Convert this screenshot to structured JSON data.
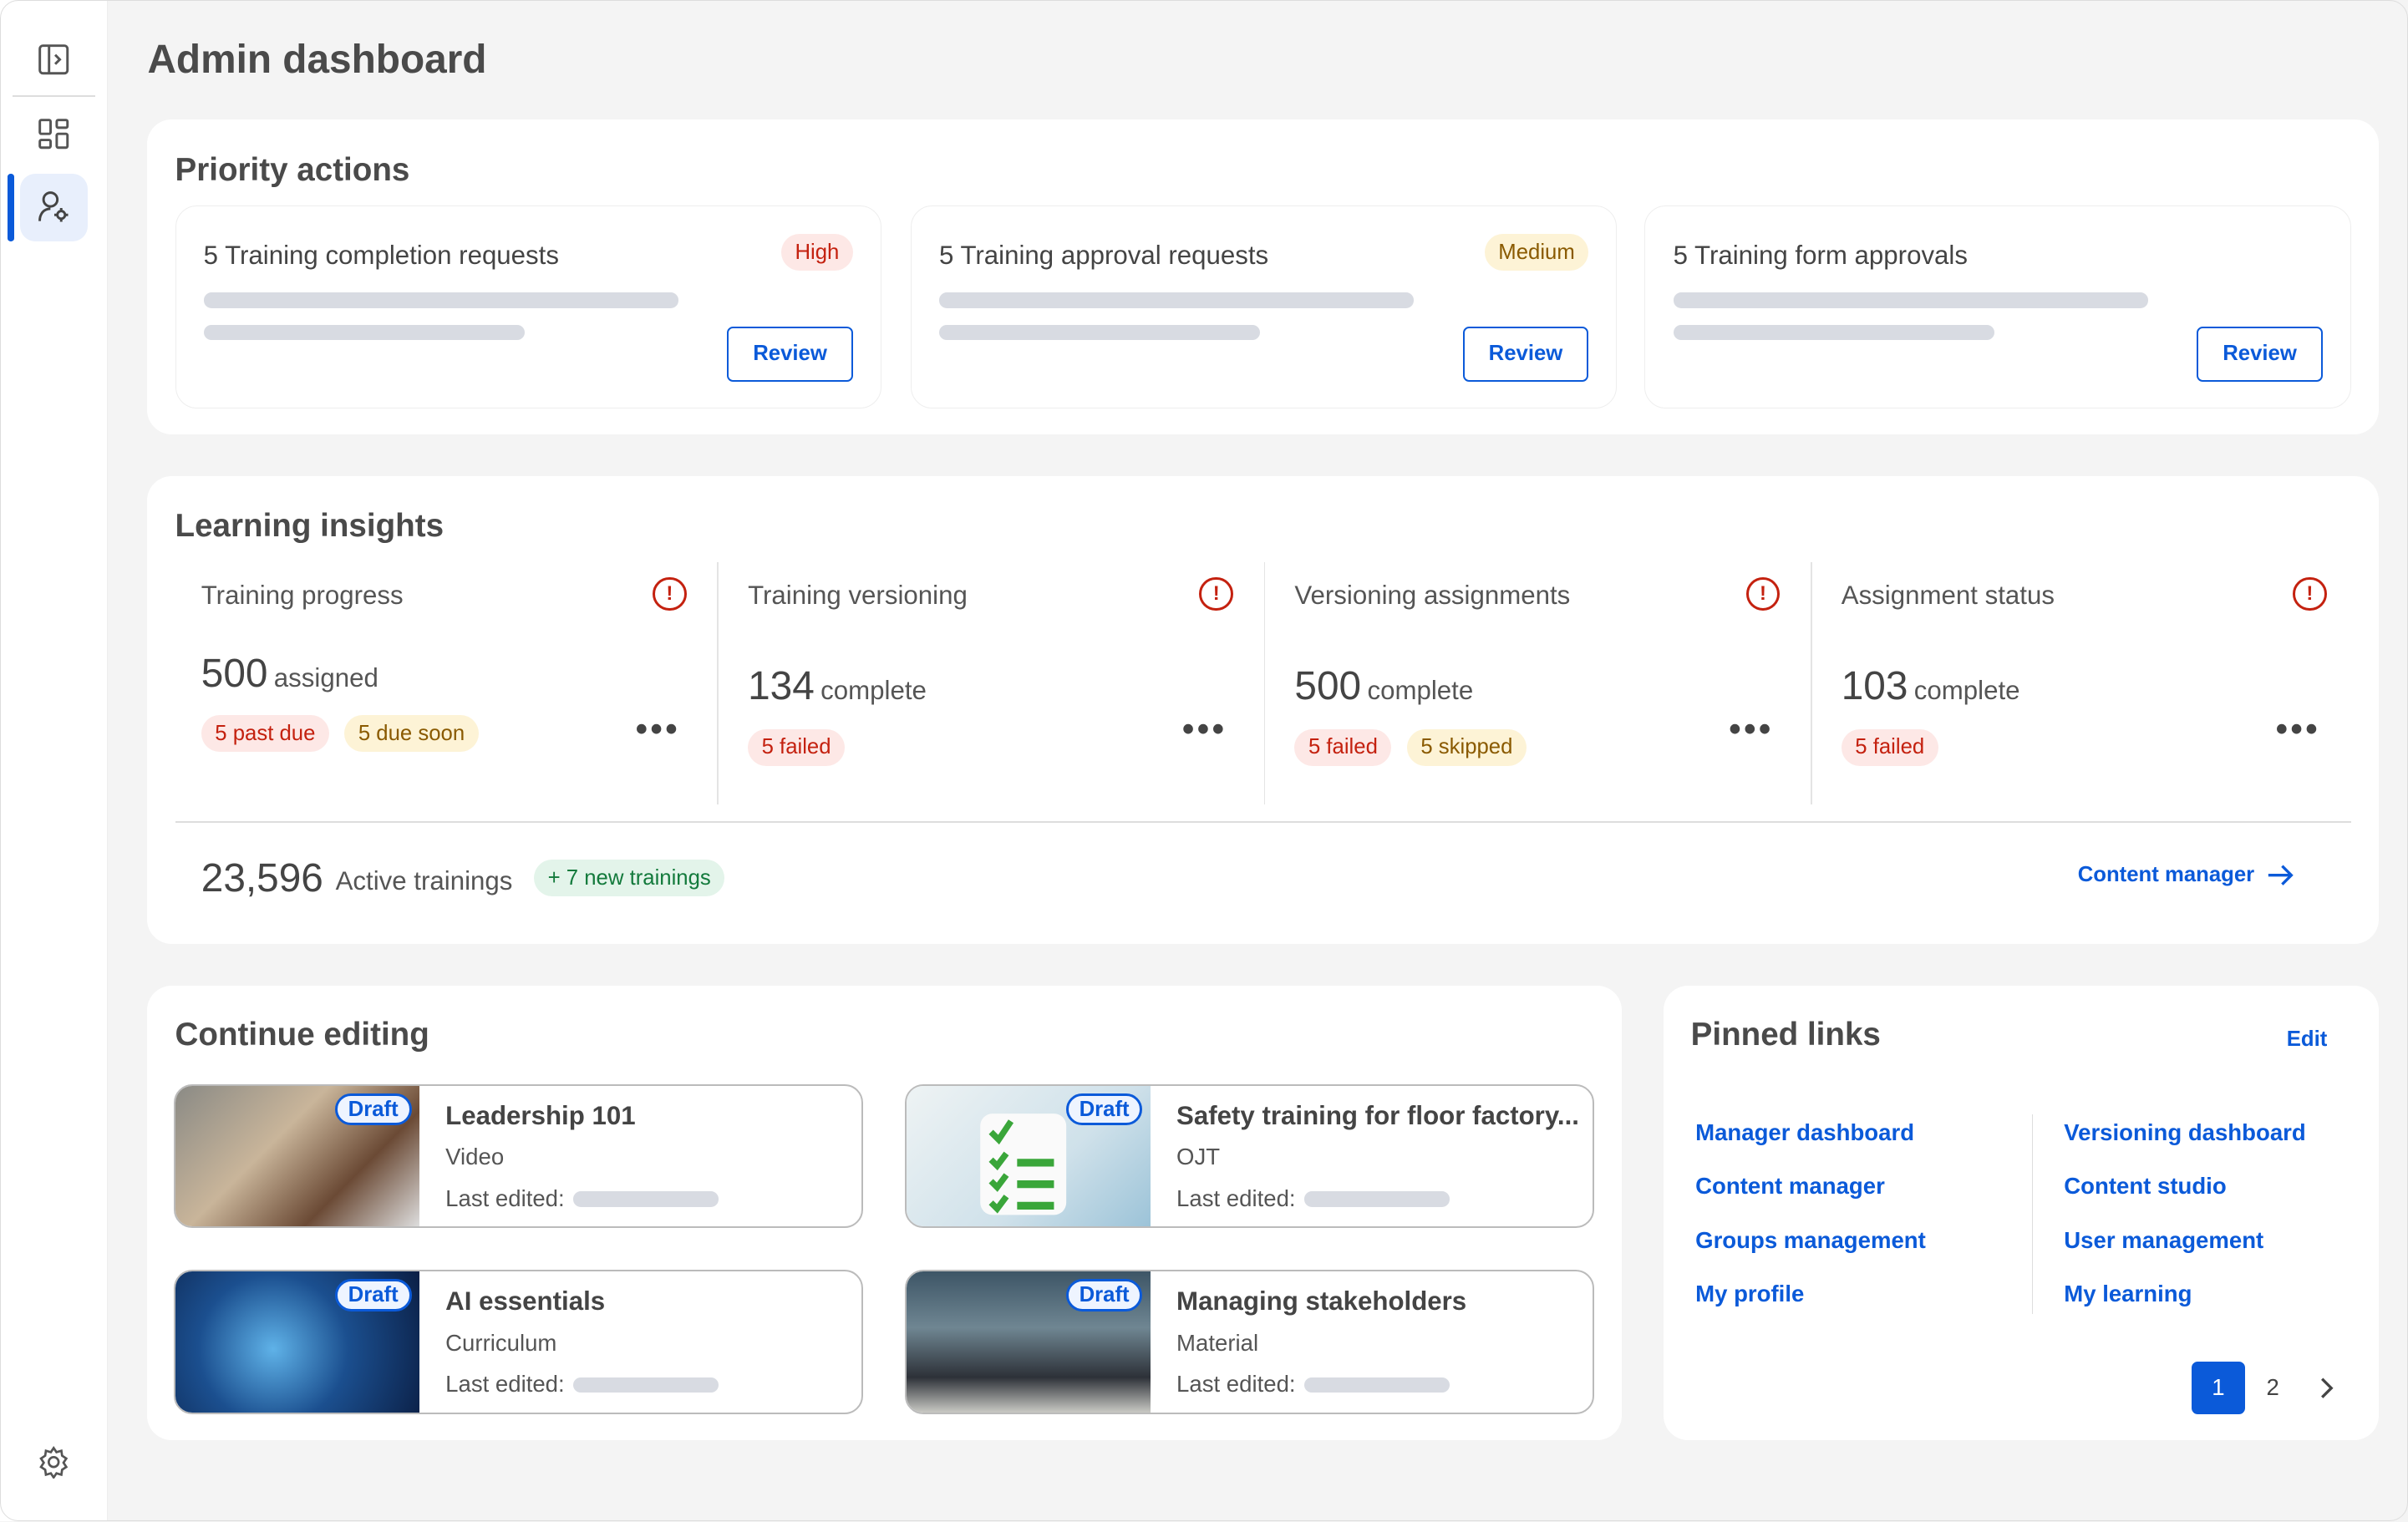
{
  "page": {
    "title": "Admin dashboard"
  },
  "sidebar": {
    "items": [
      {
        "icon": "panel-expand-icon"
      },
      {
        "icon": "dashboard-grid-icon"
      },
      {
        "icon": "user-settings-icon",
        "active": true
      }
    ],
    "footer_icon": "settings-gear-icon"
  },
  "priority": {
    "title": "Priority actions",
    "items": [
      {
        "label": "5 Training completion requests",
        "badge": "High",
        "button": "Review"
      },
      {
        "label": "5 Training approval requests",
        "badge": "Medium",
        "button": "Review"
      },
      {
        "label": "5 Training form approvals",
        "button": "Review"
      }
    ]
  },
  "insights": {
    "title": "Learning insights",
    "columns": [
      {
        "title": "Training progress",
        "value": "500",
        "unit": "assigned",
        "badges": [
          "5 past due",
          "5 due soon"
        ]
      },
      {
        "title": "Training versioning",
        "value": "134",
        "unit": "complete",
        "badges": [
          "5 failed"
        ]
      },
      {
        "title": "Versioning assignments",
        "value": "500",
        "unit": "complete",
        "badges": [
          "5 failed",
          "5 skipped"
        ]
      },
      {
        "title": "Assignment status",
        "value": "103",
        "unit": "complete",
        "badges": [
          "5 failed"
        ]
      }
    ],
    "more": "•••",
    "warn": "!",
    "active_count": "23,596",
    "active_label": "Active trainings",
    "new_badge": "+ 7 new trainings",
    "link": "Content manager"
  },
  "editing": {
    "title": "Continue editing",
    "draft": "Draft",
    "last_edited": "Last edited:",
    "items": [
      {
        "title": "Leadership 101",
        "type": "Video"
      },
      {
        "title": "Safety training for floor factory...",
        "type": "OJT"
      },
      {
        "title": "AI essentials",
        "type": "Curriculum"
      },
      {
        "title": "Managing stakeholders",
        "type": "Material"
      }
    ]
  },
  "pinned": {
    "title": "Pinned links",
    "edit": "Edit",
    "links": [
      "Manager dashboard",
      "Versioning dashboard",
      "Content manager",
      "Content studio",
      "Groups management",
      "User management",
      "My profile",
      "My learning"
    ],
    "pages": [
      "1",
      "2"
    ],
    "current_page": 1
  },
  "colors": {
    "accent": "#0b5ad9",
    "danger": "#c4210f"
  }
}
